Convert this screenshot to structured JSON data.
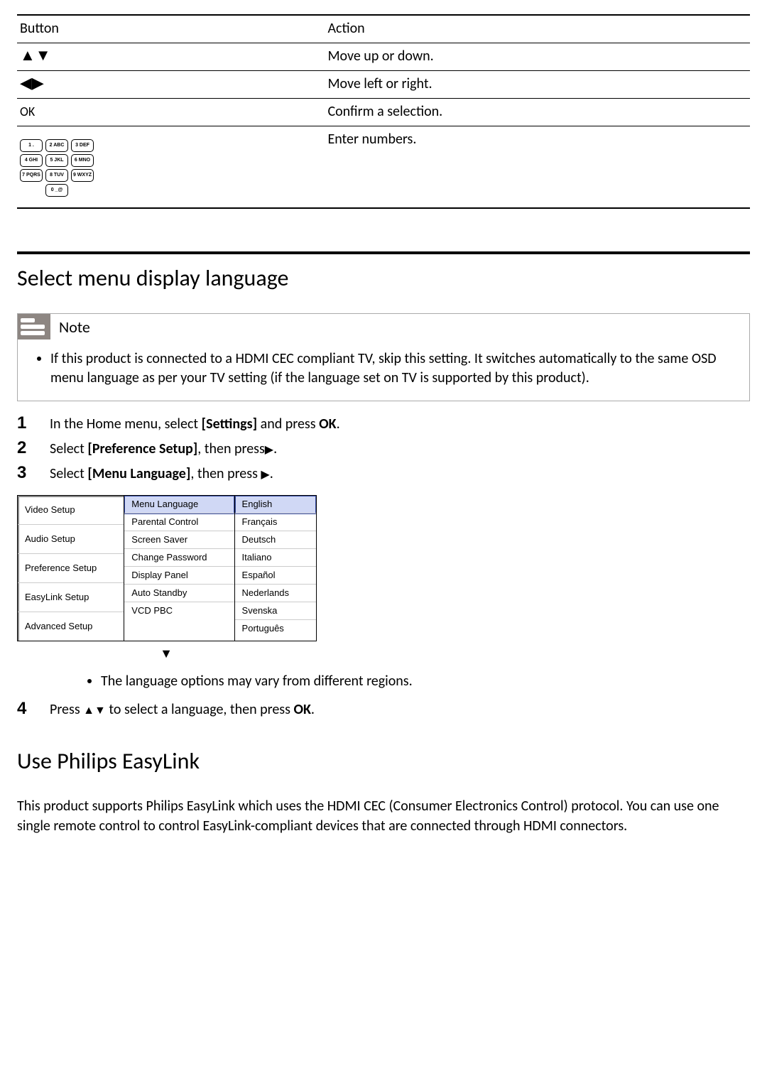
{
  "btnTable": {
    "h1": "Button",
    "h2": "Action",
    "rows": [
      {
        "btn_icons": "updown",
        "action": "Move up or down."
      },
      {
        "btn_icons": "leftright",
        "action": "Move left or right."
      },
      {
        "btn_text": "OK",
        "action": "Confirm a selection."
      },
      {
        "btn_icons": "keypad",
        "action": "Enter numbers."
      }
    ]
  },
  "keypad": [
    "1 .",
    "2 ABC",
    "3 DEF",
    "4 GHI",
    "5 JKL",
    "6 MNO",
    "7 PQRS",
    "8 TUV",
    "9 WXYZ",
    "0 _@"
  ],
  "section1": {
    "title": "Select menu display language",
    "note_label": "Note",
    "note_text": "If this product is connected to a HDMI CEC compliant TV, skip this setting. It switches automatically to the same OSD menu language as per your TV setting (if the language set on TV is supported by this product).",
    "step1a": "In the Home menu, select ",
    "step1b": "[Settings]",
    "step1c": " and press ",
    "step1d": "OK",
    "step1e": ".",
    "step2a": "Select ",
    "step2b": "[Preference Setup]",
    "step2c": ", then press",
    "step2_arrow": "▶",
    "step2d": ".",
    "step3a": "Select ",
    "step3b": "[Menu Language]",
    "step3c": ", then press ",
    "step3_arrow": "▶",
    "step3d": ".",
    "osd": {
      "col1": [
        "Video Setup",
        "Audio Setup",
        "Preference Setup",
        "EasyLink Setup",
        "Advanced Setup"
      ],
      "col2": [
        "Menu Language",
        "Parental Control",
        "Screen Saver",
        "Change Password",
        "Display Panel",
        "Auto Standby",
        "VCD PBC"
      ],
      "col3": [
        "English",
        "Français",
        "Deutsch",
        "Italiano",
        "Español",
        "Nederlands",
        "Svenska",
        "Português"
      ]
    },
    "bullet": "The language options may vary from different regions.",
    "step4a": "Press ",
    "step4_arrow": "▲▼",
    "step4b": " to select a language, then press ",
    "step4c": "OK",
    "step4d": "."
  },
  "section2": {
    "title": "Use Philips EasyLink",
    "para": "This product supports Philips EasyLink which uses the HDMI CEC (Consumer Electronics Control) protocol. You can use one single remote control to control EasyLink-compliant devices that are connected through HDMI connectors."
  }
}
